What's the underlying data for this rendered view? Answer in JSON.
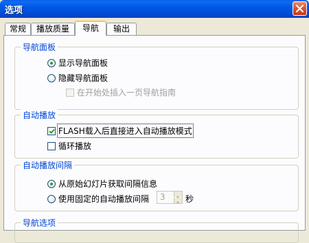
{
  "window": {
    "title": "选项"
  },
  "tabs": [
    "常规",
    "播放质量",
    "导航",
    "输出"
  ],
  "active_tab_index": 2,
  "groups": {
    "nav_panel": {
      "label": "导航面板",
      "show_panel": "显示导航面板",
      "hide_panel": "隐藏导航面板",
      "insert_guide": "在开始处插入一页导航指南"
    },
    "autoplay": {
      "label": "自动播放",
      "flash_mode": "FLASH载入后直接进入自动播放模式",
      "loop": "循环播放"
    },
    "interval": {
      "label": "自动播放间隔",
      "from_source": "从原始幻灯片获取间隔信息",
      "fixed": "使用固定的自动播放间隔",
      "fixed_value": "3",
      "unit": "秒"
    },
    "nav_options": {
      "label": "导航选项"
    }
  },
  "state": {
    "show_panel_selected": true,
    "flash_mode_checked": true,
    "loop_checked": false,
    "from_source_selected": true
  },
  "icons": {
    "close": "close-icon",
    "spin_up": "arrow-up-icon",
    "spin_down": "arrow-down-icon"
  },
  "colors": {
    "title_bar": "#0058e6",
    "group_label": "#0046d5",
    "dialog_bg": "#ece9d8"
  }
}
